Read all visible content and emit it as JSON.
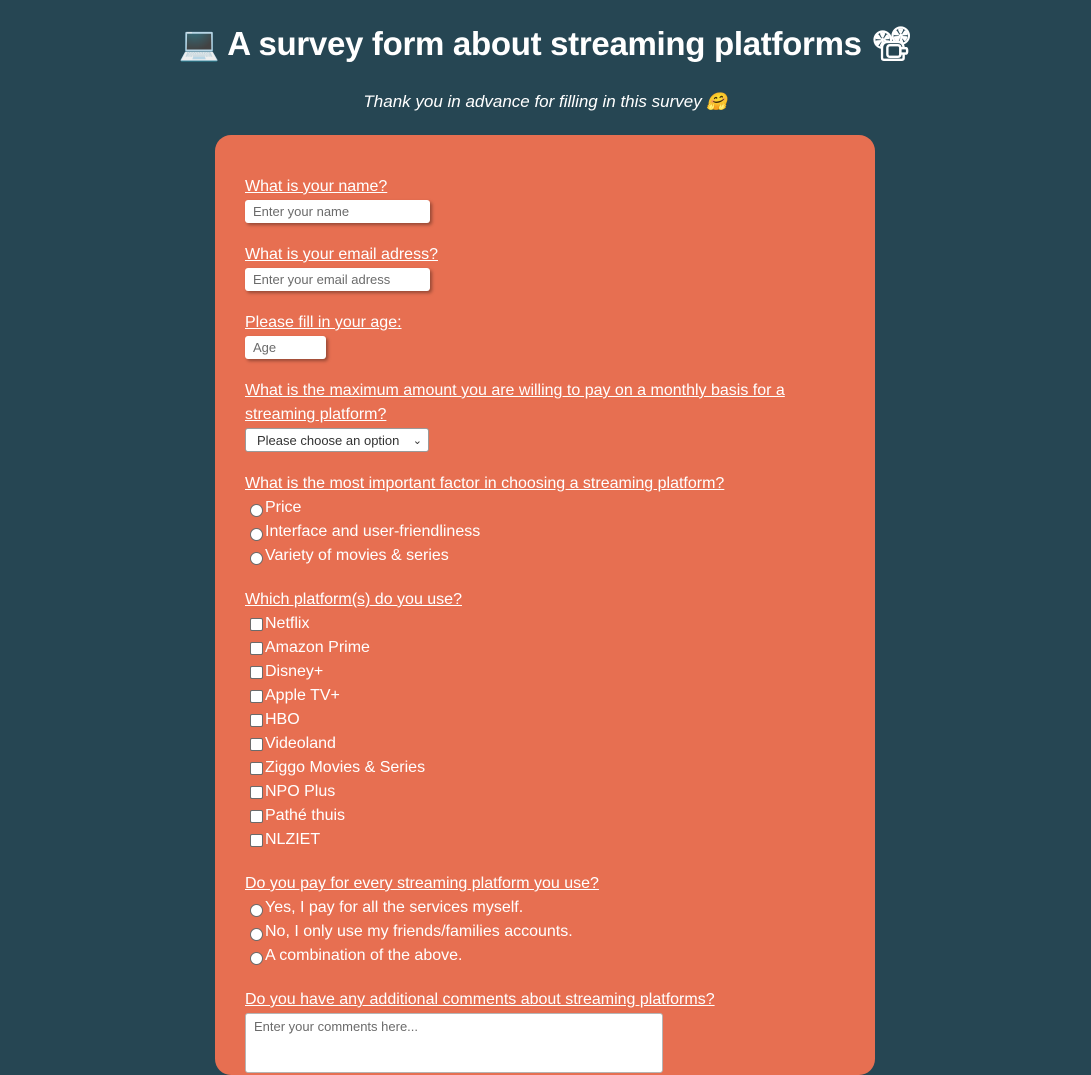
{
  "header": {
    "title_icon_left": "💻",
    "title_text": "A survey form about streaming platforms",
    "title_icon_right": "📽",
    "subtitle": "Thank you in advance for filling in this survey 🤗"
  },
  "colors": {
    "background": "#264653",
    "card": "#e76f51",
    "text": "#ffffff"
  },
  "form": {
    "name": {
      "label": "What is your name?",
      "placeholder": "Enter your name"
    },
    "email": {
      "label": "What is your email adress?",
      "placeholder": "Enter your email adress"
    },
    "age": {
      "label": "Please fill in your age:",
      "placeholder": "Age"
    },
    "price": {
      "label": "What is the maximum amount you are willing to pay on a monthly basis for a streaming platform?",
      "selected": "Please choose an option"
    },
    "factor": {
      "label": "What is the most important factor in choosing a streaming platform?",
      "options": [
        "Price",
        "Interface and user-friendliness",
        "Variety of movies & series"
      ]
    },
    "platforms": {
      "label": "Which platform(s) do you use?",
      "options": [
        "Netflix",
        "Amazon Prime",
        "Disney+",
        "Apple TV+",
        "HBO",
        "Videoland",
        "Ziggo Movies & Series",
        "NPO Plus",
        "Pathé thuis",
        "NLZIET"
      ]
    },
    "payment": {
      "label": "Do you pay for every streaming platform you use?",
      "options": [
        "Yes, I pay for all the services myself.",
        "No, I only use my friends/families accounts.",
        "A combination of the above."
      ]
    },
    "comments": {
      "label": "Do you have any additional comments about streaming platforms?",
      "placeholder": "Enter your comments here..."
    }
  }
}
